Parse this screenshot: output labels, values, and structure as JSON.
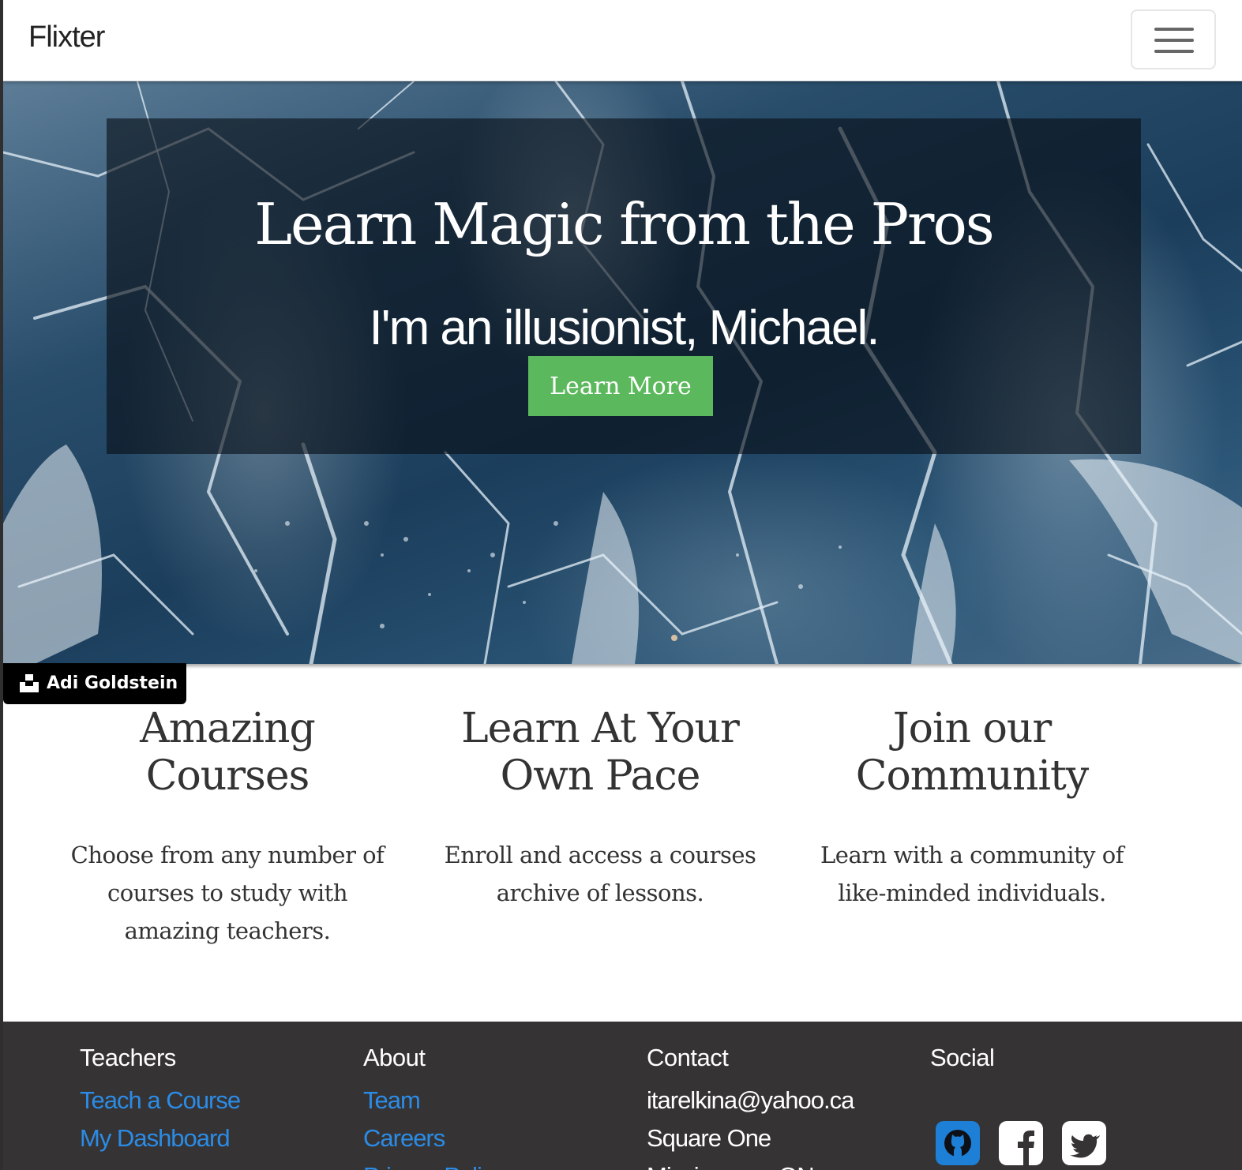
{
  "navbar": {
    "brand": "Flixter",
    "toggle_icon": "hamburger-menu-icon"
  },
  "hero": {
    "title": "Learn Magic from the Pros",
    "subtitle": "I'm an illusionist, Michael.",
    "button_label": "Learn More",
    "button_color": "#5cb85c"
  },
  "photo_credit": {
    "icon": "camera-icon",
    "name": "Adi Goldstein"
  },
  "features": [
    {
      "title_line1": "Amazing",
      "title_line2": "Courses",
      "text": "Choose from any number of courses to study with amazing teachers."
    },
    {
      "title_line1": "Learn At Your",
      "title_line2": "Own Pace",
      "text": "Enroll and access a courses archive of lessons."
    },
    {
      "title_line1": "Join our",
      "title_line2": "Community",
      "text": "Learn with a community of like-minded individuals."
    }
  ],
  "footer": {
    "background": "#363334",
    "link_color": "#2b8ce6",
    "teachers": {
      "heading": "Teachers",
      "links": [
        "Teach a Course",
        "My Dashboard"
      ]
    },
    "about": {
      "heading": "About",
      "links": [
        "Team",
        "Careers",
        "Privacy Policy"
      ]
    },
    "contact": {
      "heading": "Contact",
      "lines": [
        "itarelkina@yahoo.ca",
        "Square One",
        "Mississauga ON"
      ]
    },
    "social": {
      "heading": "Social",
      "icons": [
        "github-icon",
        "facebook-icon",
        "twitter-icon"
      ],
      "github_color": "#1e7fd6"
    }
  }
}
